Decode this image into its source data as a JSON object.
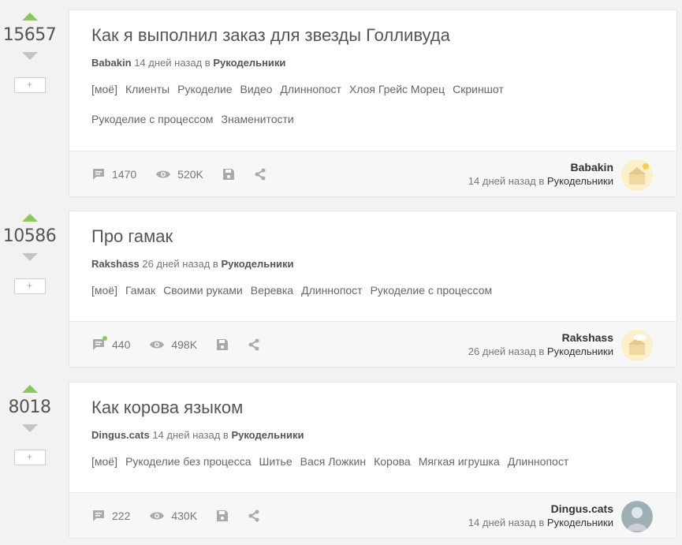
{
  "posts": [
    {
      "rating": "15657",
      "title": "Как я выполнил заказ для звезды Голливуда",
      "author": "Babakin",
      "time": "14 дней назад в",
      "community": "Рукодельники",
      "tags": [
        "[моё]",
        "Клиенты",
        "Рукоделие",
        "Видео",
        "Длиннопост",
        "Хлоя Грейс Морец",
        "Скриншот",
        "Рукоделие с процессом",
        "Знаменитости"
      ],
      "comments": "1470",
      "views": "520K",
      "save_label": "+"
    },
    {
      "rating": "10586",
      "title": "Про гамак",
      "author": "Rakshass",
      "time": "26 дней назад в",
      "community": "Рукодельники",
      "tags": [
        "[моё]",
        "Гамак",
        "Своими руками",
        "Веревка",
        "Длиннопост",
        "Рукоделие с процессом"
      ],
      "comments": "440",
      "views": "498K",
      "save_label": "+"
    },
    {
      "rating": "8018",
      "title": "Как корова языком",
      "author": "Dingus.cats",
      "time": "14 дней назад в",
      "community": "Рукодельники",
      "tags": [
        "[моё]",
        "Рукоделие без процесса",
        "Шитье",
        "Вася Ложкин",
        "Корова",
        "Мягкая игрушка",
        "Длиннопост"
      ],
      "comments": "222",
      "views": "430K",
      "save_label": "+"
    }
  ],
  "colors": {
    "upvote": "#8ac858",
    "downvote": "#c4c4c4",
    "unread": "#8ac858"
  },
  "icons": [
    "arrow-up-icon",
    "arrow-down-icon",
    "comment-icon",
    "eye-icon",
    "save-icon",
    "share-icon"
  ]
}
